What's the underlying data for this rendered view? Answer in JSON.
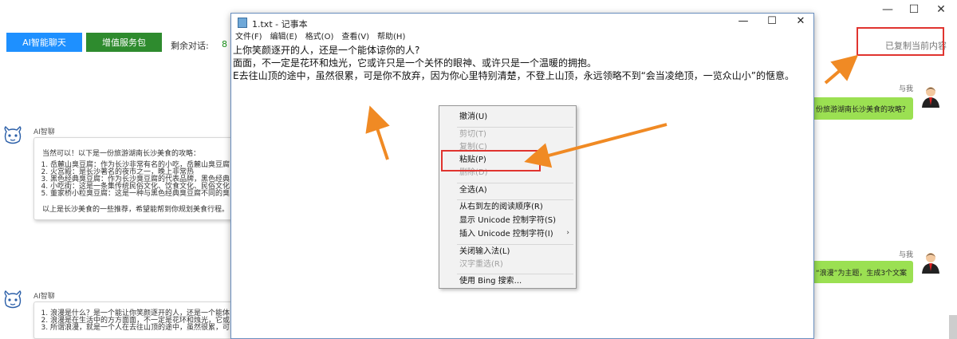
{
  "window_controls": {
    "minimize": "—",
    "maximize": "☐",
    "close": "✕"
  },
  "toolbar": {
    "ai_chat_button": "AI智能聊天",
    "value_service_button": "增值服务包",
    "remaining_label": "剩余对话:",
    "remaining_value": "8",
    "copied_label": "已复制当前内容"
  },
  "chat": {
    "messages": [
      {
        "sender": "AI智聊",
        "intro": "当然可以！以下是一份旅游湖南长沙美食的攻略：",
        "items": [
          "岳麓山臭豆腐：作为长沙非常有名的小吃，岳麓山臭豆腐",
          "火宫殿：是长沙著名的夜市之一，晚上非常热",
          "黑色经典臭豆腐：作为长沙臭豆腐的代表品牌，黑色经典",
          "小吃街：这是一条集传统民俗文化、饮食文化、民俗文化",
          "董家桥小粒臭豆腐：这是一种与黑色经典臭豆腐不同的臭"
        ],
        "outro": "以上是长沙美食的一些推荐，希望能帮到你规划美食行程。"
      },
      {
        "sender": "AI智聊",
        "items": [
          "浪漫是什么？是一个能让你笑颜逐开的人，还是一个能体",
          "浪漫是在生活中的方方面面，不一定是花环和烛光，它或",
          "所谓浪漫，就是一个人在去往山顶的途中，虽然很累，可"
        ]
      }
    ],
    "user_messages": [
      {
        "sender": "与我",
        "text": "份旅游湖南长沙美食的攻略？"
      },
      {
        "sender": "与我",
        "text": "“浪漫”为主题，生成3个文案"
      }
    ]
  },
  "notepad": {
    "title": "1.txt - 记事本",
    "controls": {
      "minimize": "—",
      "maximize": "☐",
      "close": "✕"
    },
    "menus": [
      "文件(F)",
      "编辑(E)",
      "格式(O)",
      "查看(V)",
      "帮助(H)"
    ],
    "lines": [
      "上你笑颜逐开的人，还是一个能体谅你的人?",
      "面面，不一定是花环和烛光，它或许只是一个关怀的眼神、或许只是一个温暖的拥抱。",
      "E去往山顶的途中，虽然很累，可是你不放弃，因为你心里特别清楚，不登上山顶，永远领略不到“会当凌绝顶，一览众山小”的惬意。"
    ]
  },
  "context_menu": {
    "items": [
      {
        "label": "撤消(U)",
        "enabled": true
      },
      {
        "label": "剪切(T)",
        "enabled": false
      },
      {
        "label": "复制(C)",
        "enabled": false
      },
      {
        "label": "粘贴(P)",
        "enabled": true
      },
      {
        "label": "删除(D)",
        "enabled": false
      },
      {
        "label": "全选(A)",
        "enabled": true
      },
      {
        "label": "从右到左的阅读顺序(R)",
        "enabled": true
      },
      {
        "label": "显示 Unicode 控制字符(S)",
        "enabled": true
      },
      {
        "label": "插入 Unicode 控制字符(I)",
        "enabled": true,
        "submenu": "›"
      },
      {
        "label": "关闭输入法(L)",
        "enabled": true
      },
      {
        "label": "汉字重选(R)",
        "enabled": false
      },
      {
        "label": "使用 Bing 搜索...",
        "enabled": true
      }
    ]
  },
  "colors": {
    "ai_button": "#1e90ff",
    "service_button": "#2e8b2e",
    "highlight_box": "#e0342f",
    "arrow": "#f08a24",
    "user_bubble": "#9be052",
    "remaining_value": "#1a8f1a"
  }
}
